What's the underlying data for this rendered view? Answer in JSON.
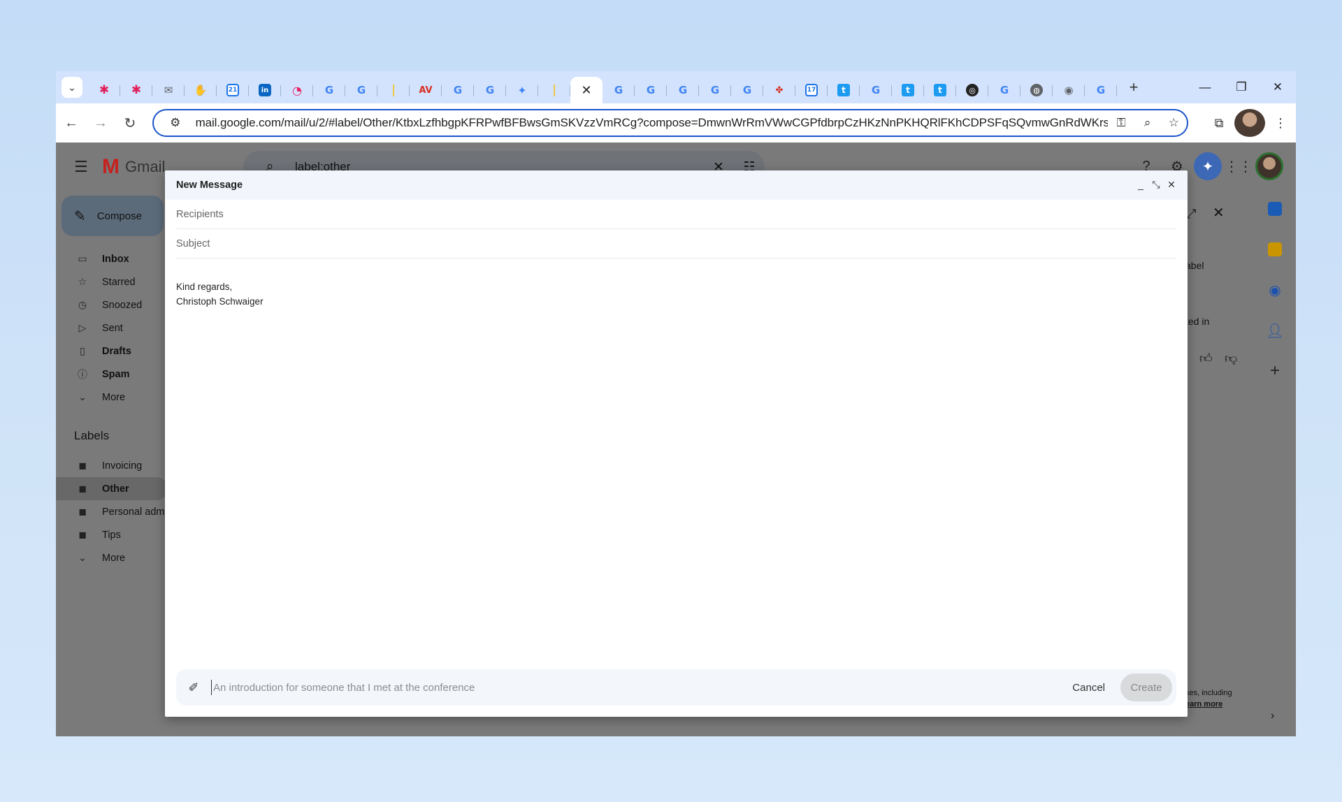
{
  "browser": {
    "tabs": [
      {
        "icon": "chevron-down-icon",
        "glyph": "⌄",
        "cls": "grey"
      },
      {
        "icon": "slack-icon",
        "glyph": "✱",
        "cls": "slack"
      },
      {
        "icon": "slack-icon",
        "glyph": "✱",
        "cls": "slack"
      },
      {
        "icon": "mail-app-icon",
        "glyph": "✉",
        "cls": "grey"
      },
      {
        "icon": "hand-icon",
        "glyph": "✋",
        "cls": "grey"
      },
      {
        "icon": "calendar-icon",
        "glyph": "21",
        "cls": "cal"
      },
      {
        "icon": "linkedin-icon",
        "glyph": "in",
        "cls": "li"
      },
      {
        "icon": "rss-icon",
        "glyph": "◔",
        "cls": "rss"
      },
      {
        "icon": "google-icon",
        "glyph": "G",
        "cls": "g"
      },
      {
        "icon": "google-icon",
        "glyph": "G",
        "cls": "g"
      },
      {
        "icon": "pin-icon",
        "glyph": "❘",
        "cls": "pin"
      },
      {
        "icon": "app-icon",
        "glyph": "AV",
        "cls": "red"
      },
      {
        "icon": "google-icon",
        "glyph": "G",
        "cls": "g"
      },
      {
        "icon": "google-icon",
        "glyph": "G",
        "cls": "g"
      },
      {
        "icon": "gemini-icon",
        "glyph": "✦",
        "cls": "star"
      },
      {
        "icon": "pin-icon",
        "glyph": "❘",
        "cls": "pin"
      },
      {
        "icon": "close-icon",
        "glyph": "✕",
        "cls": "x",
        "active": true
      },
      {
        "icon": "google-icon",
        "glyph": "G",
        "cls": "g"
      },
      {
        "icon": "google-icon",
        "glyph": "G",
        "cls": "g"
      },
      {
        "icon": "google-icon",
        "glyph": "G",
        "cls": "g"
      },
      {
        "icon": "google-icon",
        "glyph": "G",
        "cls": "g"
      },
      {
        "icon": "google-icon",
        "glyph": "G",
        "cls": "g"
      },
      {
        "icon": "pinwheel-icon",
        "glyph": "✤",
        "cls": "red"
      },
      {
        "icon": "calendar-icon",
        "glyph": "17",
        "cls": "cal"
      },
      {
        "icon": "t-icon",
        "glyph": "t",
        "cls": "t"
      },
      {
        "icon": "google-icon",
        "glyph": "G",
        "cls": "g"
      },
      {
        "icon": "t-icon",
        "glyph": "t",
        "cls": "t"
      },
      {
        "icon": "t-icon",
        "glyph": "t",
        "cls": "t"
      },
      {
        "icon": "target-icon",
        "glyph": "◎",
        "cls": "dark"
      },
      {
        "icon": "google-icon",
        "glyph": "G",
        "cls": "g"
      },
      {
        "icon": "globe-icon",
        "glyph": "◍",
        "cls": "globe"
      },
      {
        "icon": "chrome-icon",
        "glyph": "◉",
        "cls": "grey"
      },
      {
        "icon": "google-icon",
        "glyph": "G",
        "cls": "g"
      }
    ],
    "url": "mail.google.com/mail/u/2/#label/Other/KtbxLzfhbgpKFRPwfBFBwsGmSKVzzVmRCg?compose=DmwnWrRmVWwCGPfdbrpCzHKzNnPKHQRlFKhCDPSFqSQvmwGnRdWKrslPHppqvRcG..."
  },
  "gmail": {
    "app_name": "Gmail",
    "search_query": "label:other",
    "compose_label": "Compose",
    "nav": [
      {
        "label": "Inbox",
        "icon": "inbox-icon",
        "glyph": "▭",
        "bold": true
      },
      {
        "label": "Starred",
        "icon": "star-icon",
        "glyph": "☆",
        "bold": false
      },
      {
        "label": "Snoozed",
        "icon": "clock-icon",
        "glyph": "◷",
        "bold": false
      },
      {
        "label": "Sent",
        "icon": "send-icon",
        "glyph": "▷",
        "bold": false
      },
      {
        "label": "Drafts",
        "icon": "draft-icon",
        "glyph": "▯",
        "bold": true
      },
      {
        "label": "Spam",
        "icon": "spam-icon",
        "glyph": "ⓘ",
        "bold": true
      },
      {
        "label": "More",
        "icon": "chevron-down-icon",
        "glyph": "⌄",
        "bold": false
      }
    ],
    "labels_heading": "Labels",
    "labels": [
      {
        "label": "Invoicing",
        "selected": false
      },
      {
        "label": "Other",
        "selected": true
      },
      {
        "label": "Personal adm",
        "selected": false
      },
      {
        "label": "Tips",
        "selected": false
      },
      {
        "label": "More",
        "selected": false,
        "more": true
      }
    ],
    "peek_texts": {
      "label": "abel",
      "listed_in": "ted in",
      "footer_a": "kes, including",
      "footer_b": "earn more"
    }
  },
  "compose": {
    "title": "New Message",
    "recipients_placeholder": "Recipients",
    "subject_placeholder": "Subject",
    "signature_line1": "Kind regards,",
    "signature_line2": "Christoph Schwaiger",
    "help_me_write_placeholder": "An introduction for someone that I met at the conference",
    "cancel_label": "Cancel",
    "create_label": "Create"
  }
}
